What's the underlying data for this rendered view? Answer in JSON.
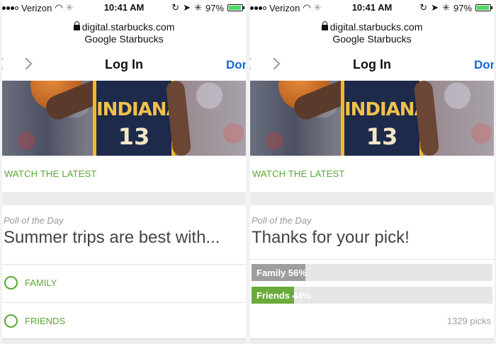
{
  "status_bar": {
    "carrier": "Verizon",
    "time": "10:41 AM",
    "battery": "97%",
    "battery_level": 0.97
  },
  "browser": {
    "domain": "digital.starbucks.com",
    "site_name": "Google Starbucks"
  },
  "nav": {
    "title": "Log In",
    "done_label": "Done",
    "back_icon": "chevron-left-icon",
    "forward_icon": "chevron-right-icon"
  },
  "hero": {
    "jersey_text": "INDIANA",
    "jersey_number": "13"
  },
  "section": {
    "watch_label": "WATCH THE LATEST"
  },
  "poll_left": {
    "label": "Poll of the Day",
    "question": "Summer trips are best with...",
    "options": [
      {
        "label": "FAMILY"
      },
      {
        "label": "FRIENDS"
      }
    ]
  },
  "poll_right": {
    "label": "Poll of the Day",
    "heading": "Thanks for your pick!",
    "results": [
      {
        "label": "Family 56%",
        "percent": 56,
        "color": "#9e9e9e"
      },
      {
        "label": "Friends 44%",
        "percent": 44,
        "color": "#6aaa3a"
      }
    ],
    "picks": "1329 picks"
  },
  "colors": {
    "accent_green": "#5aa833",
    "link_blue": "#1b65d4"
  }
}
